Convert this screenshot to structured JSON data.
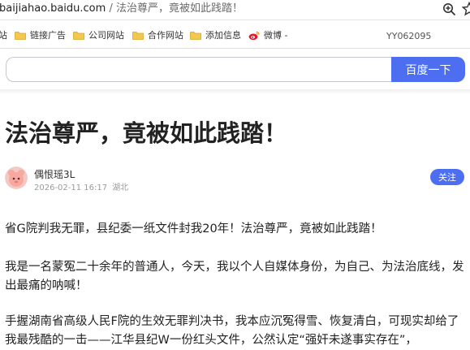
{
  "browser": {
    "url_host": "baijiahao.baidu.com",
    "url_separator": "/",
    "url_path": "法治尊严，竟被如此践踏！",
    "icons": [
      "zoom-icon",
      "star-icon"
    ]
  },
  "bookmarks": {
    "items": [
      {
        "label": "站",
        "icon": "folder-icon"
      },
      {
        "label": "链接广告",
        "icon": "folder-icon"
      },
      {
        "label": "公司网站",
        "icon": "folder-icon"
      },
      {
        "label": "合作网站",
        "icon": "folder-icon"
      },
      {
        "label": "添加信息",
        "icon": "folder-icon"
      },
      {
        "label": "微博 -",
        "icon": "weibo-icon"
      }
    ],
    "right_text": "YY062095"
  },
  "search": {
    "value": "",
    "button_label": "百度一下",
    "accent": "#4e6ef2"
  },
  "article": {
    "title": "法治尊严，竟被如此践踏！",
    "author": "偶恨瑶3L",
    "datetime": "2026-02-11 16:17",
    "region": "湖北",
    "follow_label": "关注",
    "paragraphs": [
      "省G院判我无罪，县纪委一纸文件封我20年！法治尊严，竟被如此践踏！",
      "我是一名蒙冤二十余年的普通人，今天，我以个人自媒体身份，为自己、为法治底线，发出最痛的呐喊！",
      "手握湖南省高级人民F院的生效无罪判决书，我本应沉冤得雪、恢复清白，可现实却给了我最残酷的一击——江华县纪W一份红头文件，公然认定“强奸未遂事实存在”，"
    ]
  }
}
